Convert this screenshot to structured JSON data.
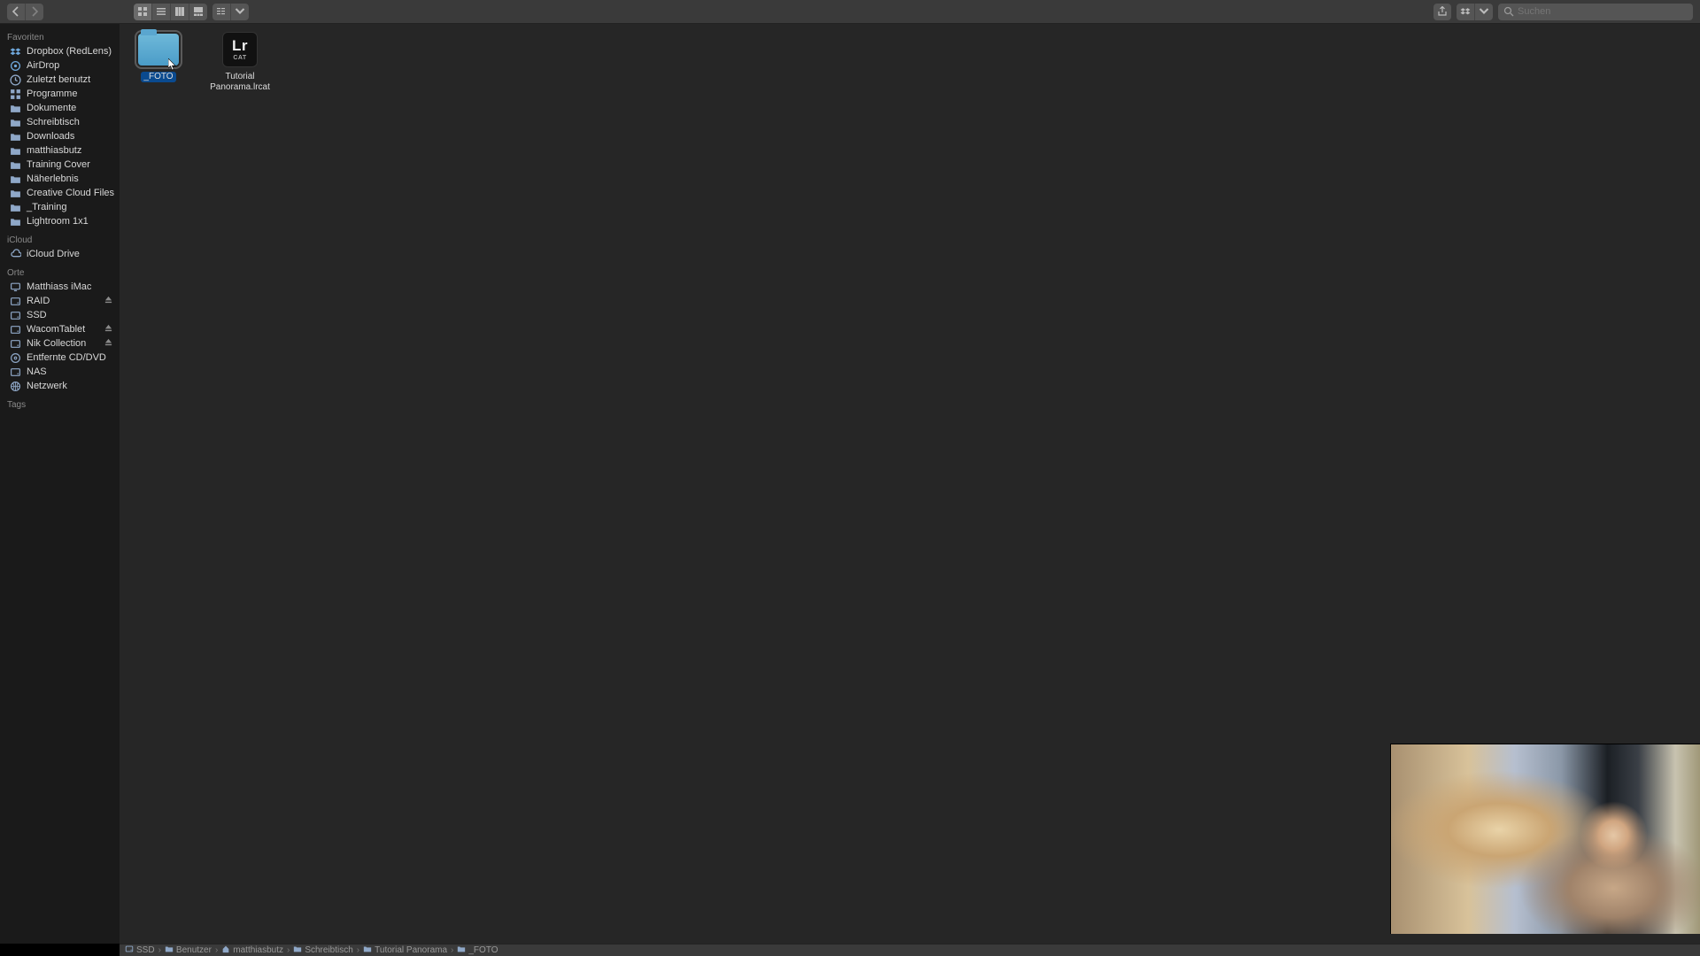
{
  "toolbar": {
    "search_placeholder": "Suchen"
  },
  "sidebar": {
    "favoriten_header": "Favoriten",
    "favoriten": [
      {
        "icon": "dropbox",
        "label": "Dropbox (RedLens)"
      },
      {
        "icon": "airdrop",
        "label": "AirDrop"
      },
      {
        "icon": "clock",
        "label": "Zuletzt benutzt"
      },
      {
        "icon": "apps",
        "label": "Programme"
      },
      {
        "icon": "folder",
        "label": "Dokumente"
      },
      {
        "icon": "folder",
        "label": "Schreibtisch"
      },
      {
        "icon": "folder",
        "label": "Downloads"
      },
      {
        "icon": "folder",
        "label": "matthiasbutz"
      },
      {
        "icon": "folder",
        "label": "Training Cover"
      },
      {
        "icon": "folder",
        "label": "Näherlebnis"
      },
      {
        "icon": "folder",
        "label": "Creative Cloud Files"
      },
      {
        "icon": "folder",
        "label": "_Training"
      },
      {
        "icon": "folder",
        "label": "Lightroom 1x1"
      }
    ],
    "icloud_header": "iCloud",
    "icloud": [
      {
        "icon": "cloud",
        "label": "iCloud Drive"
      }
    ],
    "orte_header": "Orte",
    "orte": [
      {
        "icon": "computer",
        "label": "Matthiass iMac",
        "eject": false
      },
      {
        "icon": "hdd",
        "label": "RAID",
        "eject": true
      },
      {
        "icon": "hdd",
        "label": "SSD",
        "eject": false
      },
      {
        "icon": "hdd",
        "label": "WacomTablet",
        "eject": true
      },
      {
        "icon": "hdd",
        "label": "Nik Collection",
        "eject": true
      },
      {
        "icon": "disc",
        "label": "Entfernte CD/DVD",
        "eject": false
      },
      {
        "icon": "hdd",
        "label": "NAS",
        "eject": false
      },
      {
        "icon": "globe",
        "label": "Netzwerk",
        "eject": false
      }
    ],
    "tags_header": "Tags"
  },
  "files": [
    {
      "kind": "folder",
      "label": "_FOTO",
      "selected": true
    },
    {
      "kind": "lrcat",
      "label": "Tutorial Panorama.lrcat",
      "selected": false,
      "badge_big": "Lr",
      "badge_small": "CAT"
    }
  ],
  "path": [
    {
      "icon": "hdd",
      "label": "SSD"
    },
    {
      "icon": "folder",
      "label": "Benutzer"
    },
    {
      "icon": "home",
      "label": "matthiasbutz"
    },
    {
      "icon": "folder",
      "label": "Schreibtisch"
    },
    {
      "icon": "folder",
      "label": "Tutorial Panorama"
    },
    {
      "icon": "folder",
      "label": "_FOTO"
    }
  ]
}
